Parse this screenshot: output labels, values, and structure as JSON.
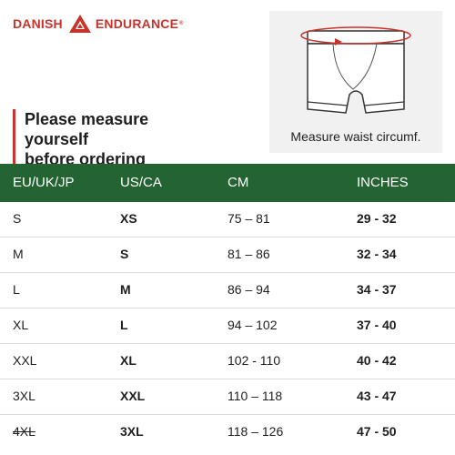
{
  "brand": {
    "name_left": "DANISH",
    "name_right": "ENDURANCE",
    "trademark": "®",
    "color": "#c8342b"
  },
  "headline": {
    "line1": "Please measure yourself",
    "line2": "before ordering"
  },
  "illustration": {
    "caption": "Measure waist circumf."
  },
  "table": {
    "header_color": "#246332",
    "headers": [
      "EU/UK/JP",
      "US/CA",
      "CM",
      "INCHES"
    ],
    "rows": [
      [
        "S",
        "XS",
        "75 – 81",
        "29 - 32"
      ],
      [
        "M",
        "S",
        "81 – 86",
        "32 - 34"
      ],
      [
        "L",
        "M",
        "86 – 94",
        "34 - 37"
      ],
      [
        "XL",
        "L",
        "94 – 102",
        "37 - 40"
      ],
      [
        "XXL",
        "XL",
        "102 - 110",
        "40 - 42"
      ],
      [
        "3XL",
        "XXL",
        "110 – 118",
        "43 - 47"
      ],
      [
        "4XL",
        "3XL",
        "118 – 126",
        "47 - 50"
      ]
    ]
  }
}
